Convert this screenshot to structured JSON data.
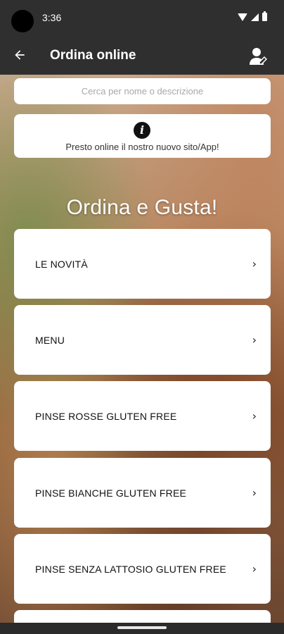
{
  "status_bar": {
    "time": "3:36",
    "icons": [
      "wifi-icon",
      "signal-icon",
      "battery-icon"
    ]
  },
  "app_bar": {
    "title": "Ordina online",
    "back_icon": "arrow-left-icon",
    "user_icon": "user-edit-icon"
  },
  "search": {
    "placeholder": "Cerca per nome o descrizione"
  },
  "notice": {
    "icon": "info-icon",
    "text": "Presto online il nostro nuovo sito/App!"
  },
  "heading": "Ordina e Gusta!",
  "categories": [
    {
      "label": "LE NOVITÀ"
    },
    {
      "label": "MENU"
    },
    {
      "label": "PINSE ROSSE GLUTEN FREE"
    },
    {
      "label": "PINSE BIANCHE GLUTEN FREE"
    },
    {
      "label": "PINSE SENZA LATTOSIO GLUTEN FREE"
    },
    {
      "label": ""
    }
  ],
  "colors": {
    "bar": "#2f2f2f",
    "card": "#ffffff",
    "placeholder": "#a8a8a8"
  }
}
